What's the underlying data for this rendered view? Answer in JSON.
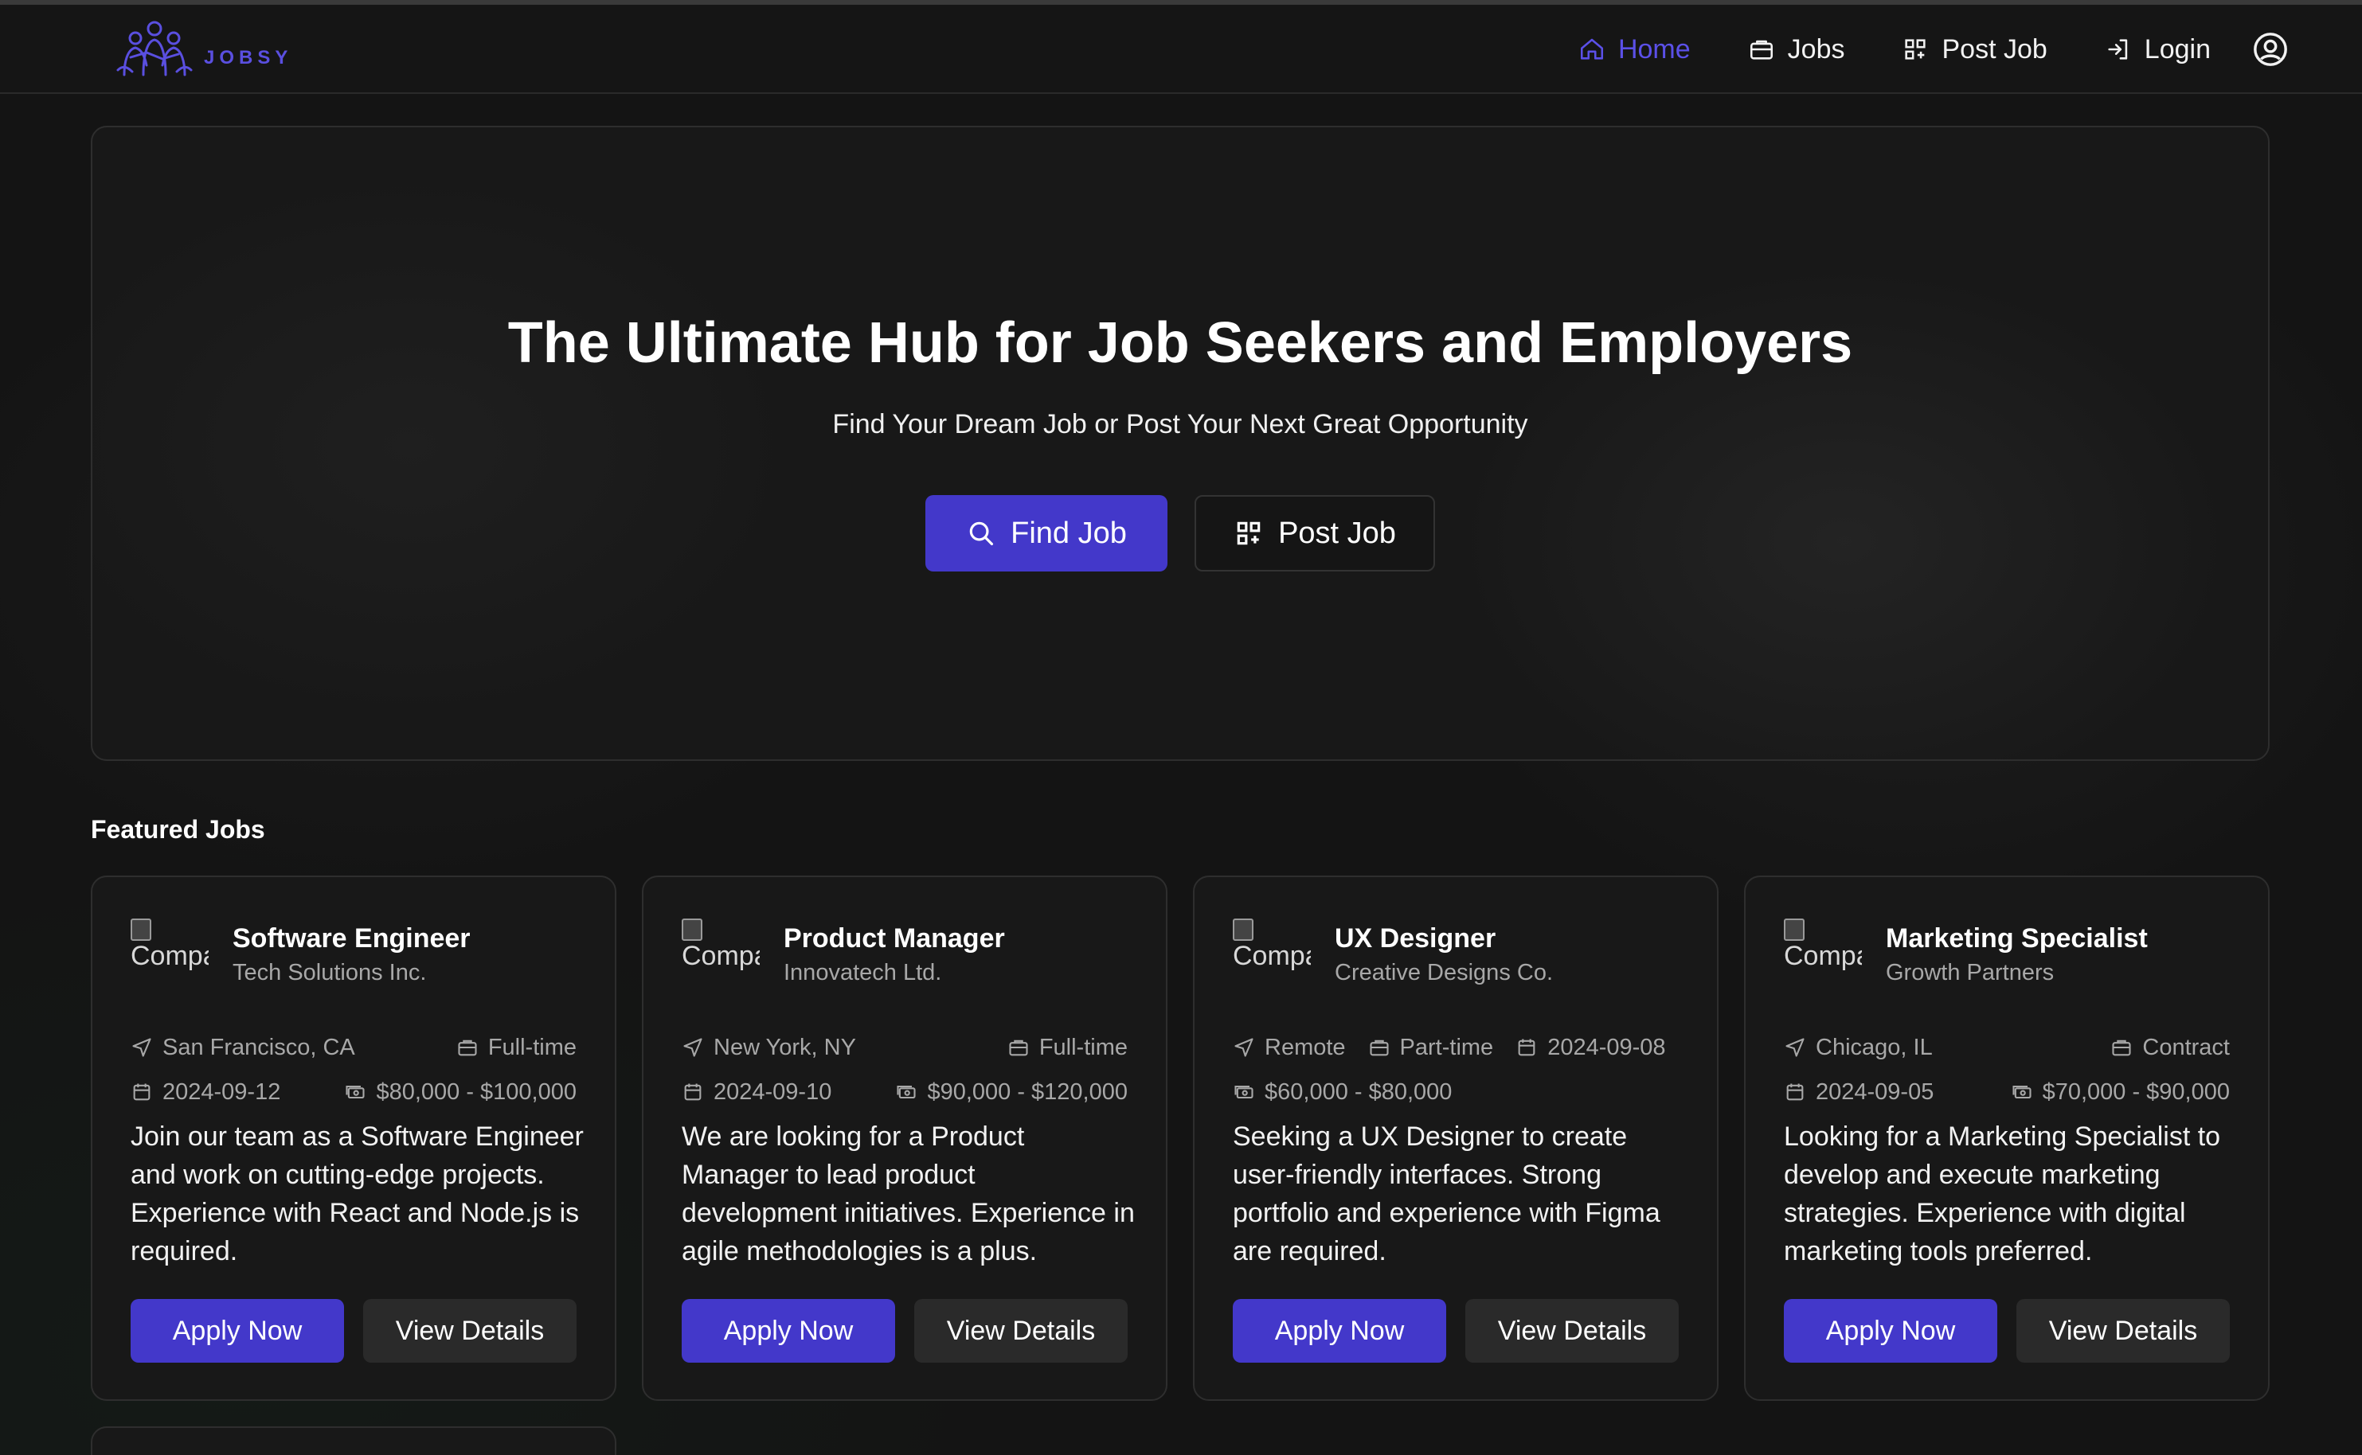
{
  "header": {
    "logo_text": "JOBSY",
    "nav": [
      {
        "label": "Home",
        "icon": "home-icon",
        "active": true
      },
      {
        "label": "Jobs",
        "icon": "briefcase-icon",
        "active": false
      },
      {
        "label": "Post Job",
        "icon": "grid-plus-icon",
        "active": false
      },
      {
        "label": "Login",
        "icon": "login-icon",
        "active": false
      }
    ],
    "user_icon": "user-circle-icon"
  },
  "hero": {
    "title": "The Ultimate Hub for Job Seekers and Employers",
    "subtitle": "Find Your Dream Job or Post Your Next Great Opportunity",
    "find_label": "Find Job",
    "post_label": "Post Job"
  },
  "featured": {
    "title": "Featured Jobs",
    "logo_alt": "Company",
    "apply_label": "Apply Now",
    "details_label": "View Details",
    "jobs": [
      {
        "title": "Software Engineer",
        "company": "Tech Solutions Inc.",
        "location": "San Francisco, CA",
        "type": "Full-time",
        "date": "2024-09-12",
        "salary": "$80,000 - $100,000",
        "description": "Join our team as a Software Engineer and work on cutting-edge projects. Experience with React and Node.js is required."
      },
      {
        "title": "Product Manager",
        "company": "Innovatech Ltd.",
        "location": "New York, NY",
        "type": "Full-time",
        "date": "2024-09-10",
        "salary": "$90,000 - $120,000",
        "description": "We are looking for a Product Manager to lead product development initiatives. Experience in agile methodologies is a plus."
      },
      {
        "title": "UX Designer",
        "company": "Creative Designs Co.",
        "location": "Remote",
        "type": "Part-time",
        "date": "2024-09-08",
        "salary": "$60,000 - $80,000",
        "description": "Seeking a UX Designer to create user-friendly interfaces. Strong portfolio and experience with Figma are required."
      },
      {
        "title": "Marketing Specialist",
        "company": "Growth Partners",
        "location": "Chicago, IL",
        "type": "Contract",
        "date": "2024-09-05",
        "salary": "$70,000 - $90,000",
        "description": "Looking for a Marketing Specialist to develop and execute marketing strategies. Experience with digital marketing tools preferred."
      }
    ]
  },
  "colors": {
    "accent": "#4338ca",
    "active_nav": "#5b50e8",
    "background": "#141414",
    "card": "#181818"
  }
}
